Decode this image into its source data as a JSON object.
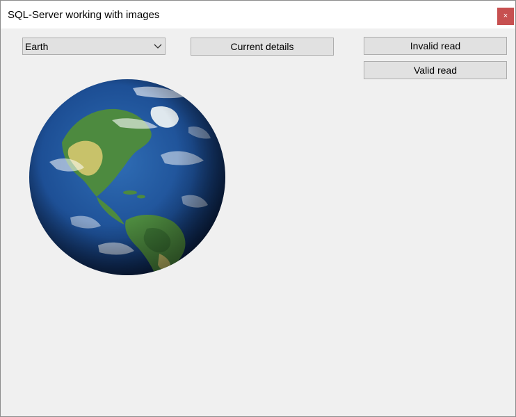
{
  "window": {
    "title": "SQL-Server working with images",
    "close_symbol": "×"
  },
  "controls": {
    "planet_select_value": "Earth",
    "current_details_label": "Current details",
    "invalid_read_label": "Invalid read",
    "valid_read_label": "Valid read"
  },
  "image": {
    "subject": "earth-globe"
  },
  "colors": {
    "close_button": "#c75050",
    "window_background": "#f0f0f0",
    "button_background": "#e1e1e1",
    "ocean": "#1d4f95",
    "land_green": "#4d8a3f",
    "land_yellow": "#c8c26a"
  }
}
